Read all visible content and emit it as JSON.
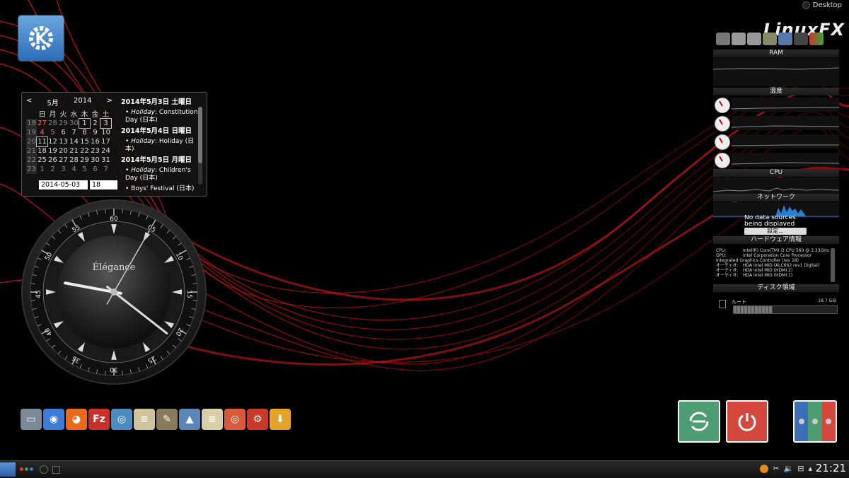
{
  "top_right": {
    "desktop_label": "Desktop",
    "brand_logo_text": "LinuxFX"
  },
  "calendar": {
    "month": "5月",
    "year": "2014",
    "prev": "<",
    "next": ">",
    "weekday_headers": [
      "日",
      "月",
      "火",
      "水",
      "木",
      "金",
      "土"
    ],
    "weeks": [
      {
        "week": "18",
        "days": [
          "27",
          "28",
          "29",
          "30",
          "1",
          "2",
          "3"
        ]
      },
      {
        "week": "19",
        "days": [
          "4",
          "5",
          "6",
          "7",
          "8",
          "9",
          "10"
        ]
      },
      {
        "week": "20",
        "days": [
          "11",
          "12",
          "13",
          "14",
          "15",
          "16",
          "17"
        ]
      },
      {
        "week": "21",
        "days": [
          "18",
          "19",
          "20",
          "21",
          "22",
          "23",
          "24"
        ]
      },
      {
        "week": "22",
        "days": [
          "25",
          "26",
          "27",
          "28",
          "29",
          "30",
          "31"
        ]
      },
      {
        "week": "23",
        "days": [
          "1",
          "2",
          "3",
          "4",
          "5",
          "6",
          "7"
        ]
      }
    ],
    "events": [
      {
        "date": "2014年5月3日 土曜日",
        "italic": "Holiday",
        "text": ": Constitution Day (日本)"
      },
      {
        "date": "2014年5月4日 日曜日",
        "italic": "Holiday",
        "text": ": Holiday (日本)"
      },
      {
        "date": "2014年5月5日 月曜日",
        "italic": "Holiday",
        "text": ": Children's Day (日本)"
      }
    ],
    "event_extra": "Boys' Festival (日本)",
    "date_input": "2014-05-03",
    "week_input": "18"
  },
  "clock": {
    "brand": "Élégance",
    "numerals": [
      "60",
      "05",
      "10",
      "15",
      "20",
      "25",
      "30",
      "35",
      "40",
      "45",
      "50",
      "55"
    ],
    "hour": 9,
    "minute": 21
  },
  "dock": {
    "items": [
      {
        "name": "file-manager-icon",
        "color": "#7a8a99",
        "glyph": "▭"
      },
      {
        "name": "chrome-icon",
        "color": "#3b7dd8",
        "glyph": "◉"
      },
      {
        "name": "firefox-icon",
        "color": "#e86b1c",
        "glyph": "◕"
      },
      {
        "name": "filezilla-icon",
        "color": "#c8302a",
        "glyph": "Fz"
      },
      {
        "name": "app-icon",
        "color": "#4a8cc0",
        "glyph": "◎"
      },
      {
        "name": "notes-icon",
        "color": "#cfc39b",
        "glyph": "≡"
      },
      {
        "name": "gimp-icon",
        "color": "#8a7a5c",
        "glyph": "✎"
      },
      {
        "name": "inkscape-icon",
        "color": "#5b87b8",
        "glyph": "▲"
      },
      {
        "name": "text-editor-icon",
        "color": "#d9ceaa",
        "glyph": "≡"
      },
      {
        "name": "disc-burner-icon",
        "color": "#d85a3a",
        "glyph": "◎"
      },
      {
        "name": "settings-icon",
        "color": "#c93a2a",
        "glyph": "⚙"
      },
      {
        "name": "installer-icon",
        "color": "#e6a32a",
        "glyph": "⬇"
      }
    ]
  },
  "monitor": {
    "ram_label": "RAM",
    "temp_label": "温度",
    "cpu_label": "CPU",
    "network_label": "ネットワーク",
    "no_data_text": "No data sources being displayed",
    "settings_label": "設定...",
    "hw_label": "ハードウェア情報",
    "hw_rows": [
      {
        "k": "CPU:",
        "v": "Intel(R) Core(TM) i3 CPU 560 @ 3.33GHz"
      },
      {
        "k": "GPU:",
        "v": "Intel Corporation Core Processor Integrated Graphics Controller (rev 18)"
      },
      {
        "k": "オーディオ:",
        "v": "HDA Intel MID (ALC662 rev1 Digital)"
      },
      {
        "k": "オーディオ:",
        "v": "HDA Intel MID (HDMI 2)"
      },
      {
        "k": "オーディオ:",
        "v": "HDA Intel MID (HDMI 1)"
      }
    ],
    "disk_label": "ディスク領域",
    "disk_name": "ルート",
    "disk_size": "18.7 GiB",
    "disk_used_fraction": 0.38
  },
  "taskbar": {
    "clock": "21:21"
  }
}
